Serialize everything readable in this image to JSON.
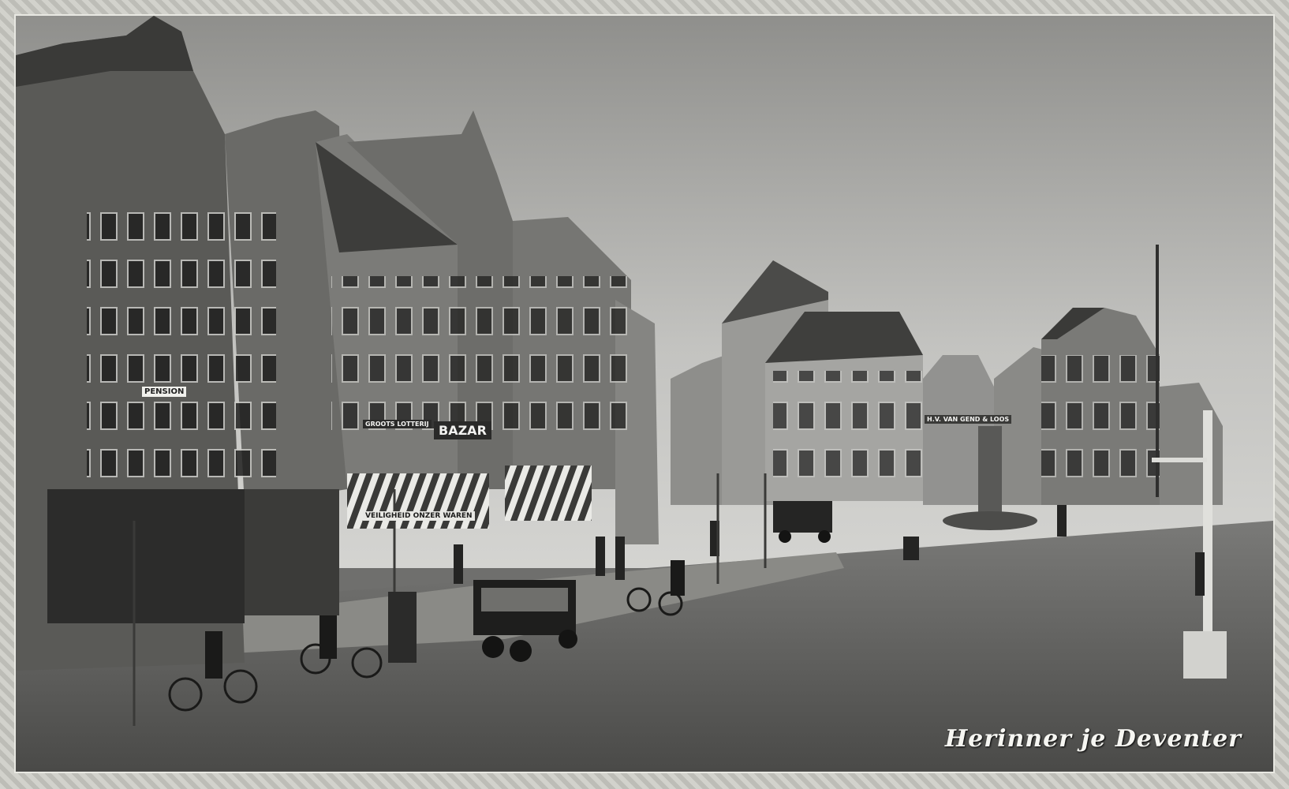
{
  "photo": {
    "description_kind": "historic black-and-white street photograph",
    "signs": {
      "pension": "PENSION",
      "bazar": "BAZAR",
      "shop_small": "GROOTS LOTTERIJ",
      "awning_text": "VEILIGHEID ONZER WAREN",
      "corner_shop": "H.V. VAN GEND & LOOS"
    },
    "watermark": "Herinner je Deventer"
  },
  "colors": {
    "sky": "#b7b7b4",
    "road": "#5b5b59",
    "facade_dark": "#3e3e3c",
    "facade_mid": "#6d6d6a",
    "roof": "#2f2f2e"
  }
}
